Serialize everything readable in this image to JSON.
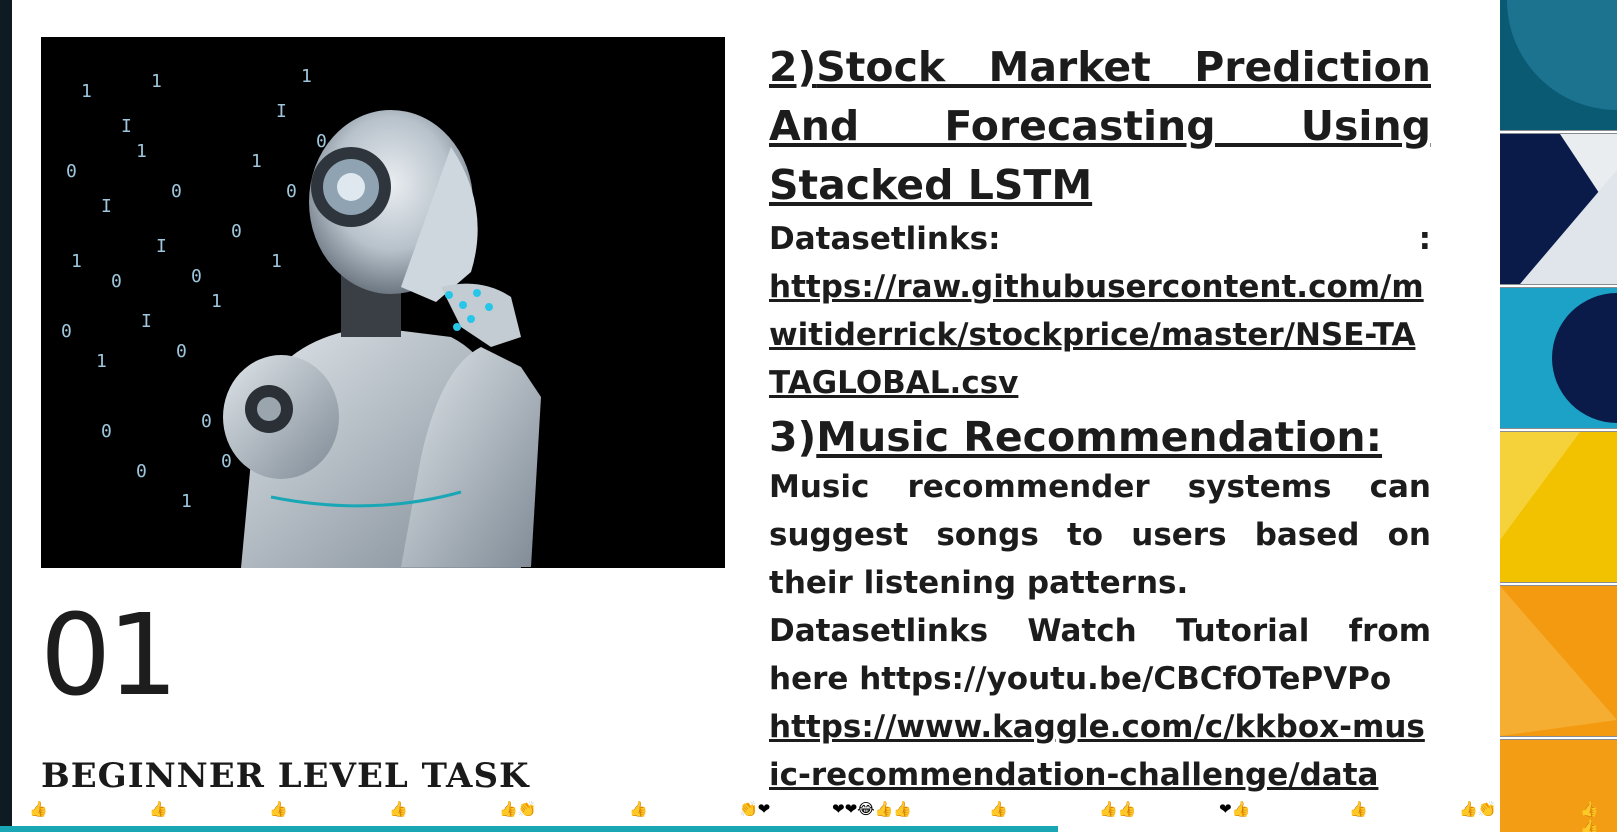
{
  "slide": {
    "number": "01",
    "task_title": "BEGINNER LEVEL TASK",
    "section2": {
      "title_prefix": "2)",
      "title": "Stock Market Prediction And Forecasting Using Stacked LSTM",
      "dataset_label": "Datasetlinks:",
      "dataset_colon": ":",
      "dataset_link": "https://raw.githubusercontent.com/mwitiderrick/stockprice/master/NSE-TATAGLOBAL.csv"
    },
    "section3": {
      "title_prefix": "3)",
      "title": "Music Recommendation:",
      "description": "Music recommender systems can suggest songs to users based on their listening patterns.",
      "dataset_line": "Datasetlinks   Watch Tutorial from here https://youtu.be/CBCfOTePVPo",
      "kaggle_link": "https://www.kaggle.com/c/kkbox-music-recommendation-challenge/data"
    }
  },
  "photo": {
    "icon": "robot-thinking-image"
  },
  "reactions": [
    {
      "glyph": "👍"
    },
    {
      "glyph": "👍"
    },
    {
      "glyph": "👍"
    },
    {
      "glyph": "👍"
    },
    {
      "glyph": "👍👏"
    },
    {
      "glyph": "👍"
    },
    {
      "glyph": "👏❤"
    },
    {
      "glyph": "❤❤😂👍👍"
    },
    {
      "glyph": "👍"
    },
    {
      "glyph": "👍👍"
    },
    {
      "glyph": "❤👍"
    },
    {
      "glyph": "👍"
    },
    {
      "glyph": "👍👏"
    },
    {
      "glyph": "👍👍"
    }
  ],
  "progress": {
    "fraction": 0.705,
    "color": "#19a7b6"
  },
  "colors": {
    "slide_bg": "#ffffff",
    "frame": "#0f1b22",
    "text": "#1c1c1c"
  }
}
